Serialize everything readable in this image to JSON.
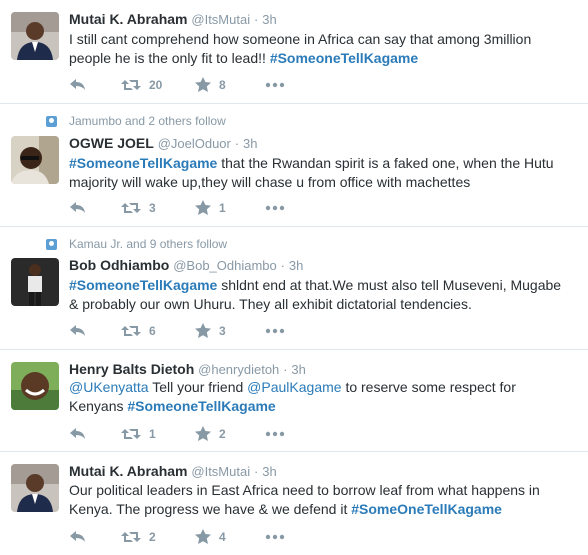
{
  "tweets": [
    {
      "context": "",
      "name": "Mutai K. Abraham",
      "handle": "@ItsMutai",
      "dot": "·",
      "time": "3h",
      "text_before": "I still cant comprehend how someone in Africa can say that among 3million people he is the only fit to lead!!",
      "hashtag": "#SomeoneTellKagame",
      "retweets": "20",
      "favorites": "8"
    },
    {
      "context": "Jamumbo and 2 others follow",
      "name": "OGWE JOEL",
      "handle": "@JoelOduor",
      "dot": "·",
      "time": "3h",
      "hashtag": "#SomeoneTellKagame",
      "text_after": "that the Rwandan spirit is a faked one, when the Hutu majority will wake up,they will chase u from office with machettes",
      "retweets": "3",
      "favorites": "1"
    },
    {
      "context": "Kamau Jr. and 9 others follow",
      "name": "Bob Odhiambo",
      "handle": "@Bob_Odhiambo",
      "dot": "·",
      "time": "3h",
      "hashtag": "#SomeoneTellKagame",
      "text_after": "shldnt end at that.We must also tell Museveni, Mugabe & probably our own Uhuru. They all exhibit dictatorial tendencies.",
      "retweets": "6",
      "favorites": "3"
    },
    {
      "context": "",
      "name": "Henry Balts Dietoh",
      "handle": "@henrydietoh",
      "dot": "·",
      "time": "3h",
      "mention1": "@UKenyatta",
      "text_mid1": "Tell your friend",
      "mention2": "@PaulKagame",
      "text_mid2": "to reserve some respect for Kenyans",
      "hashtag": "#SomeoneTellKagame",
      "retweets": "1",
      "favorites": "2"
    },
    {
      "context": "",
      "name": "Mutai K. Abraham",
      "handle": "@ItsMutai",
      "dot": "·",
      "time": "3h",
      "text_before": "Our political leaders in East Africa need to borrow leaf from what happens in Kenya. The progress we have & we defend it",
      "hashtag": "#SomeOneTellKagame",
      "retweets": "2",
      "favorites": "4"
    }
  ],
  "colors": {
    "link": "#2b7bb9",
    "muted": "#8899a6",
    "text": "#292f33",
    "divider": "#e1e8ed"
  },
  "icons": {
    "reply": "reply-icon",
    "retweet": "retweet-icon",
    "favorite": "star-icon",
    "more": "more-icon"
  }
}
